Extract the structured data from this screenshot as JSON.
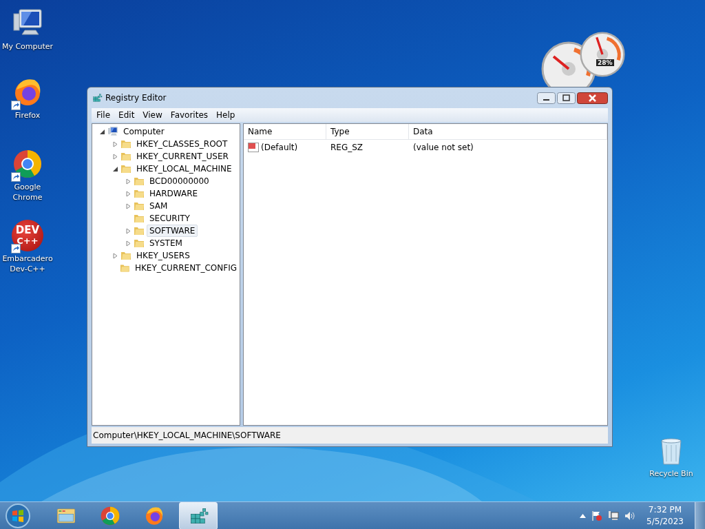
{
  "desktop_icons": [
    {
      "kind": "computer",
      "label": "My Computer",
      "shortcut": false
    },
    {
      "kind": "firefox",
      "label": "Firefox",
      "shortcut": true
    },
    {
      "kind": "chrome",
      "label": "Google Chrome",
      "shortcut": true
    },
    {
      "kind": "devcpp",
      "label": "Embarcadero Dev-C++",
      "shortcut": true,
      "logo": [
        "DEV",
        "C++"
      ]
    },
    {
      "kind": "recycle",
      "label": "Recycle Bin",
      "shortcut": false
    }
  ],
  "gadget": {
    "reading": "28%"
  },
  "window": {
    "title": "Registry Editor",
    "menu": [
      "File",
      "Edit",
      "View",
      "Favorites",
      "Help"
    ],
    "tree": [
      {
        "label": "Computer",
        "kind": "branch",
        "expanded": true,
        "selected": false,
        "children": [
          {
            "label": "HKEY_CLASSES_ROOT",
            "kind": "branch",
            "expanded": false,
            "selected": false
          },
          {
            "label": "HKEY_CURRENT_USER",
            "kind": "branch",
            "expanded": false,
            "selected": false
          },
          {
            "label": "HKEY_LOCAL_MACHINE",
            "kind": "branch",
            "expanded": true,
            "selected": false,
            "children": [
              {
                "label": "BCD00000000",
                "kind": "branch",
                "expanded": false,
                "selected": false
              },
              {
                "label": "HARDWARE",
                "kind": "branch",
                "expanded": false,
                "selected": false
              },
              {
                "label": "SAM",
                "kind": "branch",
                "expanded": false,
                "selected": false
              },
              {
                "label": "SECURITY",
                "kind": "leaf",
                "selected": false
              },
              {
                "label": "SOFTWARE",
                "kind": "branch",
                "expanded": false,
                "selected": true
              },
              {
                "label": "SYSTEM",
                "kind": "branch",
                "expanded": false,
                "selected": false
              }
            ]
          },
          {
            "label": "HKEY_USERS",
            "kind": "branch",
            "expanded": false,
            "selected": false
          },
          {
            "label": "HKEY_CURRENT_CONFIG",
            "kind": "leaf",
            "selected": false
          }
        ]
      }
    ],
    "columns": [
      "Name",
      "Type",
      "Data"
    ],
    "rows": [
      {
        "name": "(Default)",
        "type": "REG_SZ",
        "data": "(value not set)"
      }
    ],
    "status_bar": "Computer\\HKEY_LOCAL_MACHINE\\SOFTWARE"
  },
  "taskbar": {
    "items": [
      {
        "kind": "explorer",
        "selected": false
      },
      {
        "kind": "chrome",
        "selected": false
      },
      {
        "kind": "firefox",
        "selected": false
      },
      {
        "kind": "regedit",
        "selected": true
      }
    ],
    "clock": {
      "time": "7:32 PM",
      "date": "5/5/2023"
    }
  }
}
